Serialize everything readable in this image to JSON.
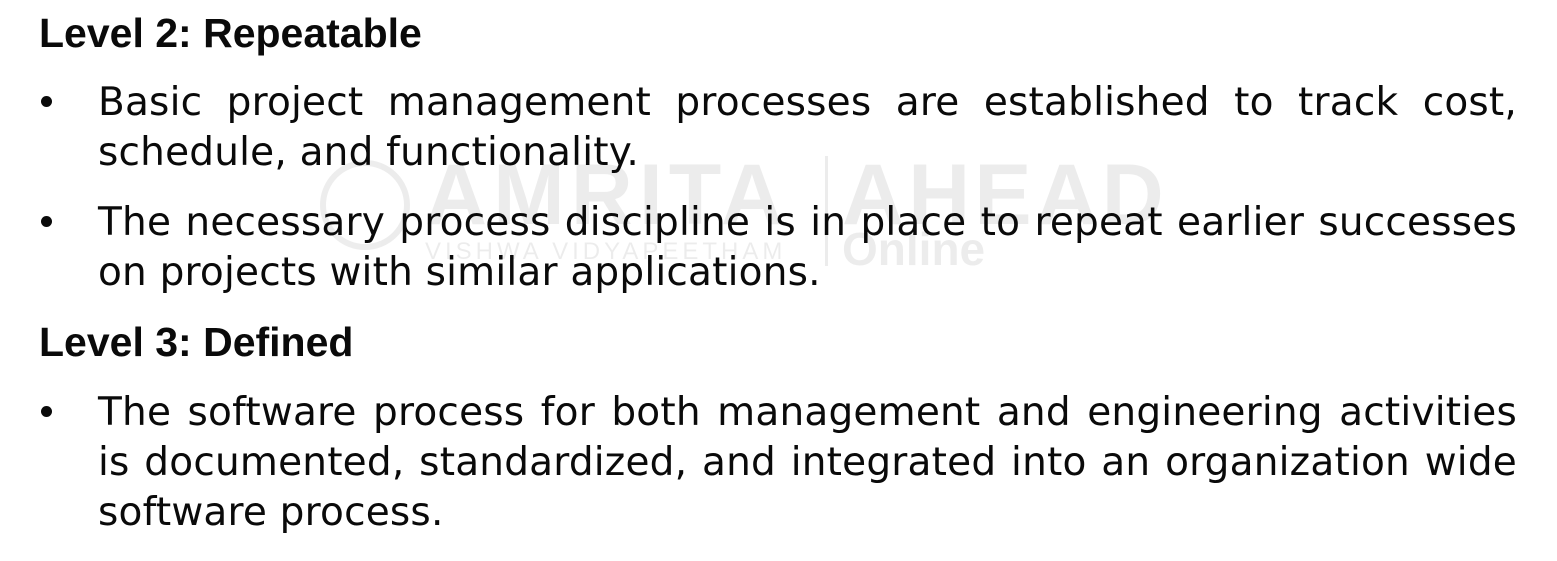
{
  "watermark": {
    "brand": "AMRITA",
    "brand_sub": "VISHWA VIDYAPEETHAM",
    "brand2": "AHEAD",
    "brand2_sub": "Online"
  },
  "sections": [
    {
      "heading": "Level 2: Repeatable",
      "bullets": [
        "Basic project management processes are established to track cost, schedule, and functionality.",
        "The necessary process discipline is in place to repeat earlier successes on projects with similar applications."
      ]
    },
    {
      "heading": "Level 3: Defined",
      "bullets": [
        "The software process for both management and engineering activities is documented, standardized, and integrated into an organization wide software process."
      ]
    }
  ]
}
